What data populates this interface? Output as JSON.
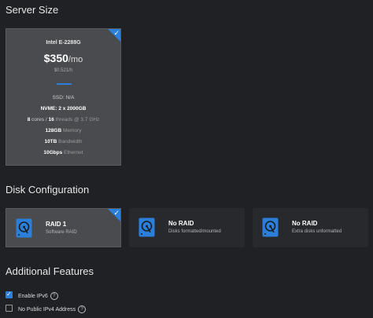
{
  "server_size": {
    "title": "Server Size",
    "card": {
      "cpu": "Intel E-2288G",
      "price": "$350",
      "price_unit": "/mo",
      "hourly": "$0.521/h",
      "ssd": "SSD: N/A",
      "nvme": "NVME: 2 x 2000GB",
      "cores": "8",
      "cores_label": "cores /",
      "threads": "16",
      "threads_label": "threads @ 3.7 GHz",
      "memory": "128GB",
      "memory_label": "Memory",
      "bandwidth": "10TB",
      "bandwidth_label": "Bandwidth",
      "ethernet": "10Gbps",
      "ethernet_label": "Ethernet",
      "selected": true
    }
  },
  "disk_configuration": {
    "title": "Disk Configuration",
    "options": [
      {
        "title": "RAID 1",
        "subtitle": "Software RAID",
        "selected": true
      },
      {
        "title": "No RAID",
        "subtitle": "Disks formatted/mounted",
        "selected": false
      },
      {
        "title": "No RAID",
        "subtitle": "Extra disks unformatted",
        "selected": false
      }
    ]
  },
  "additional_features": {
    "title": "Additional Features",
    "items": [
      {
        "label": "Enable IPv6",
        "checked": true
      },
      {
        "label": "No Public IPv4 Address",
        "checked": false
      }
    ]
  },
  "colors": {
    "accent": "#2b7fd9",
    "background": "#1f2125",
    "card_selected": "#4a4b4f",
    "card_plain": "#27292d"
  },
  "icons": {
    "check": "check-icon",
    "disk": "hard-drive-icon",
    "help": "help-circle-icon"
  }
}
